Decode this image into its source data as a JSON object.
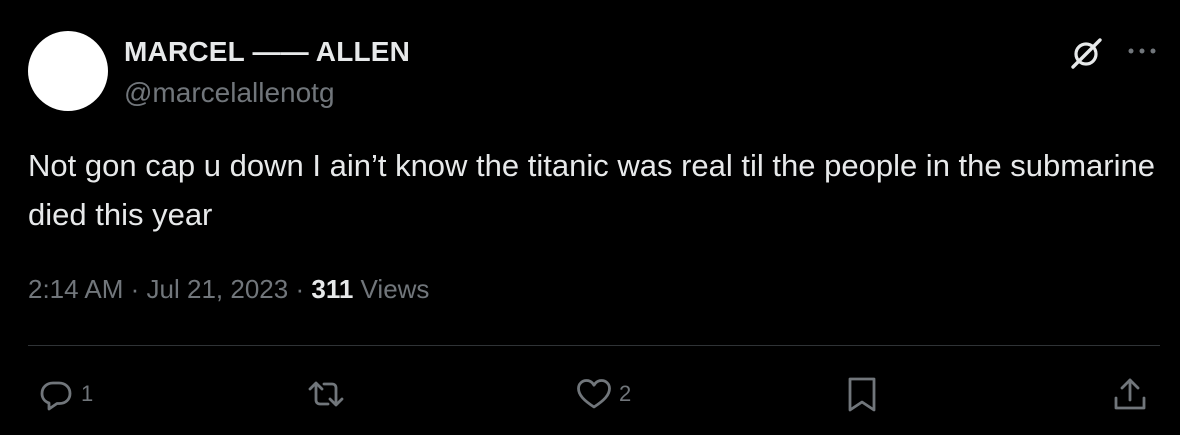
{
  "author": {
    "display_name": "MARCEL —— ALLEN",
    "handle": "@marcelallenotg"
  },
  "tweet": {
    "text": "Not gon cap u down I ain’t know the titanic was real til the people in the submarine died this year",
    "time": "2:14 AM",
    "separator": "·",
    "date": "Jul 21, 2023",
    "views_count": "311",
    "views_label": "Views"
  },
  "actions": {
    "reply_count": "1",
    "like_count": "2"
  },
  "icons": {
    "header": [
      "grok-icon",
      "more-icon"
    ],
    "actions": [
      "reply-icon",
      "retweet-icon",
      "like-icon",
      "bookmark-icon",
      "share-icon"
    ]
  },
  "colors": {
    "background": "#000000",
    "primary_text": "#e7e9ea",
    "secondary_text": "#71767b",
    "divider": "#2f3336",
    "avatar": "#ffffff"
  }
}
